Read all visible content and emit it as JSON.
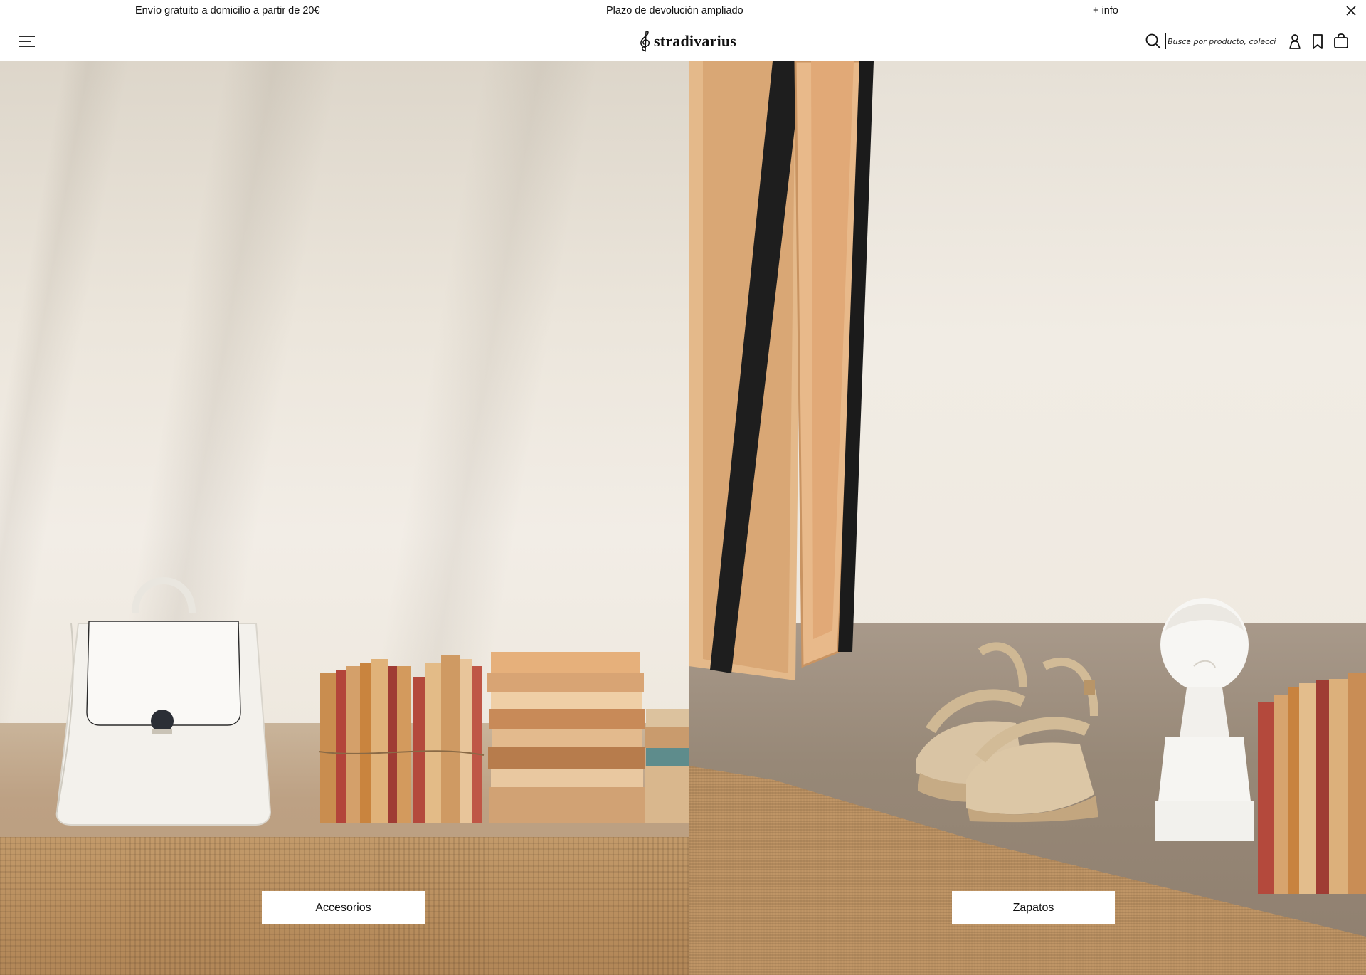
{
  "promo": {
    "left": "Envío gratuito a domicilio a partir de 20€",
    "center": "Plazo de devolución ampliado",
    "right": "+ info",
    "close_icon": "close-icon"
  },
  "header": {
    "menu_icon": "hamburger-menu-icon",
    "logo_text": "stradivarius",
    "search": {
      "placeholder": "Busca por producto, colección...",
      "value": "",
      "icon": "search-icon"
    },
    "icons": [
      "user-icon",
      "bookmark-icon",
      "shopping-bag-icon"
    ]
  },
  "hero": {
    "left": {
      "button_label": "Accesorios"
    },
    "right": {
      "button_label": "Zapatos"
    }
  },
  "colors": {
    "background": "#ffffff",
    "text": "#111111",
    "wall": "#ece6dc",
    "rug": "#c29a6a"
  }
}
